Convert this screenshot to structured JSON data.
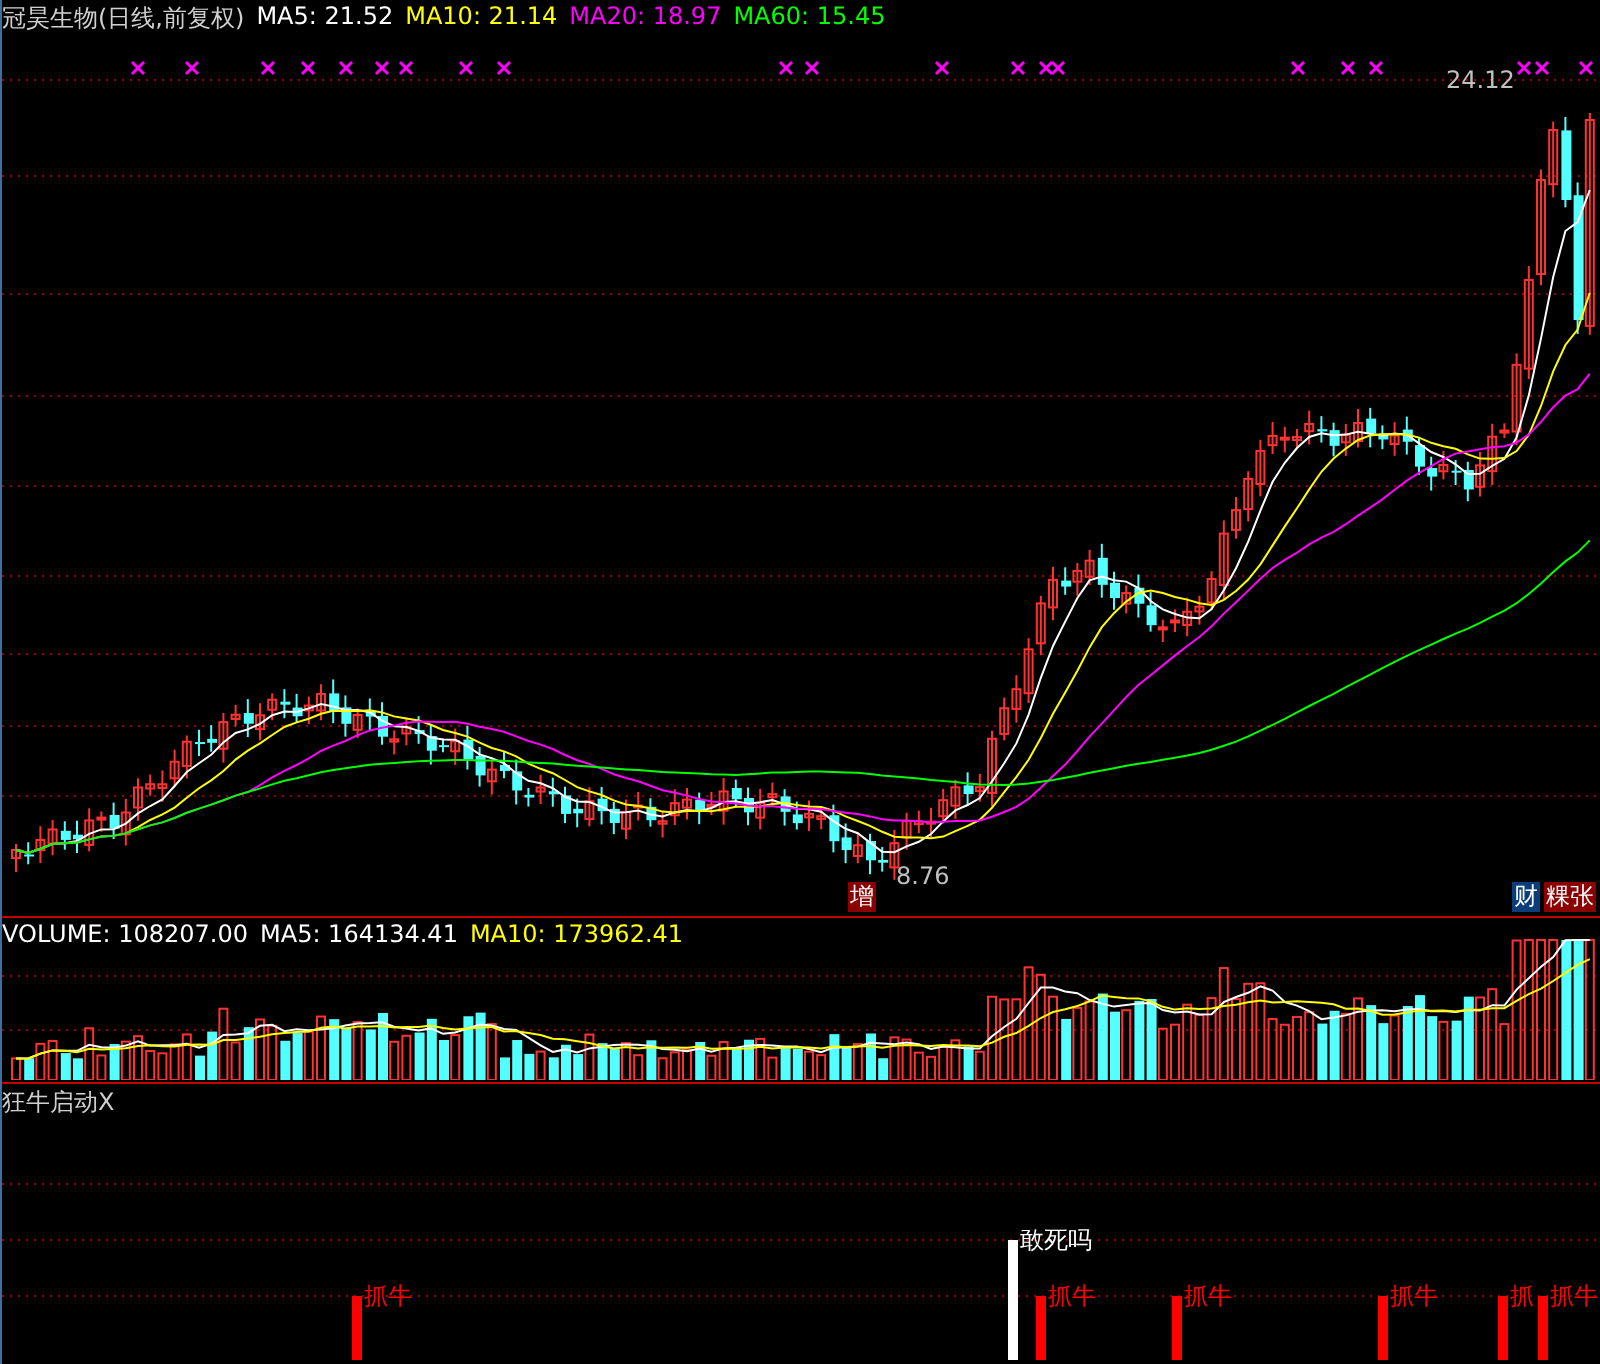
{
  "main_panel": {
    "title": "冠昊生物(日线,前复权)",
    "indicators": [
      {
        "text": "MA5: 21.52",
        "color": "#ffffff"
      },
      {
        "text": "MA10: 21.14",
        "color": "#ffff00"
      },
      {
        "text": "MA20: 18.97",
        "color": "#ff00ff"
      },
      {
        "text": "MA60: 15.45",
        "color": "#00ff00"
      }
    ],
    "high_label": "24.12",
    "low_label": "8.76",
    "badges": [
      {
        "text": "增",
        "kind": "left"
      },
      {
        "text": "财",
        "kind": "finance"
      },
      {
        "text": "粿张",
        "kind": "margin"
      }
    ]
  },
  "volume_panel": {
    "indicators": [
      {
        "text": "VOLUME: 108207.00",
        "color": "#ffffff"
      },
      {
        "text": "MA5: 164134.41",
        "color": "#ffffff"
      },
      {
        "text": "MA10: 173962.41",
        "color": "#ffff00"
      }
    ]
  },
  "signal_panel": {
    "title": "狂牛启动X",
    "signals": [
      {
        "label": "抓牛",
        "kind": "buy"
      },
      {
        "label": "敢死吗",
        "kind": "alert"
      },
      {
        "label": "抓牛",
        "kind": "buy"
      },
      {
        "label": "抓牛",
        "kind": "buy"
      },
      {
        "label": "抓牛",
        "kind": "buy"
      },
      {
        "label": "抓",
        "kind": "buy"
      },
      {
        "label": "抓牛",
        "kind": "buy"
      }
    ]
  }
}
